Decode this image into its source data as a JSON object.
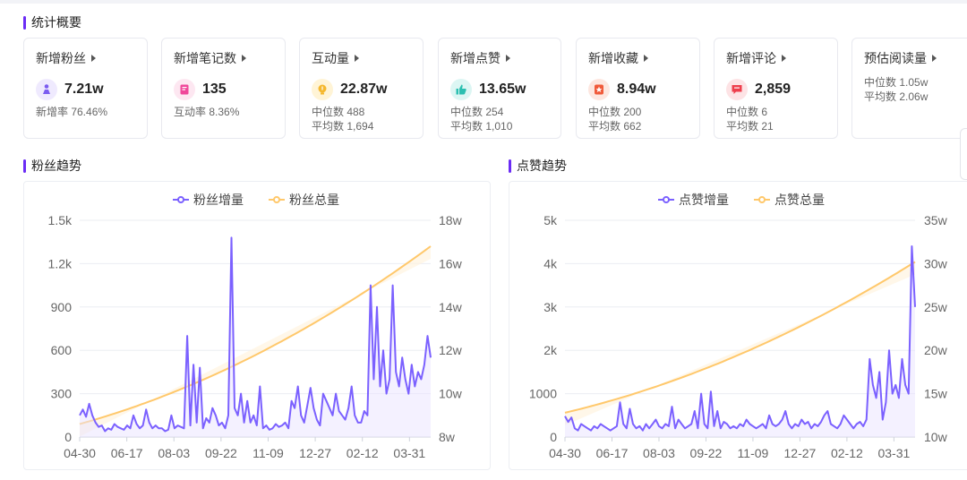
{
  "overview": {
    "title": "统计概要",
    "cards": [
      {
        "title": "新增粉丝",
        "value": "7.21w",
        "icon": "fans-icon",
        "icon_color": "#7b5cf0",
        "icon_bg": "#efeafe",
        "lines": [
          "新增率 76.46%"
        ]
      },
      {
        "title": "新增笔记数",
        "value": "135",
        "icon": "note-icon",
        "icon_color": "#f0479a",
        "icon_bg": "#fde7f1",
        "lines": [
          "互动率 8.36%"
        ]
      },
      {
        "title": "互动量",
        "value": "22.87w",
        "icon": "interaction-icon",
        "icon_color": "#f5b82e",
        "icon_bg": "#fff4d6",
        "lines": [
          "中位数 488",
          "平均数 1,694"
        ]
      },
      {
        "title": "新增点赞",
        "value": "13.65w",
        "icon": "thumb-up-icon",
        "icon_color": "#2bbfb0",
        "icon_bg": "#dcf6f3",
        "lines": [
          "中位数 254",
          "平均数 1,010"
        ]
      },
      {
        "title": "新增收藏",
        "value": "8.94w",
        "icon": "star-icon",
        "icon_color": "#f05a3a",
        "icon_bg": "#fde6df",
        "lines": [
          "中位数 200",
          "平均数 662"
        ]
      },
      {
        "title": "新增评论",
        "value": "2,859",
        "icon": "comment-icon",
        "icon_color": "#ee3f4d",
        "icon_bg": "#fde3e5",
        "lines": [
          "中位数 6",
          "平均数 21"
        ]
      },
      {
        "title": "预估阅读量",
        "value": "",
        "icon": "",
        "icon_color": "",
        "icon_bg": "",
        "lines": [
          "中位数 1.05w",
          "平均数 2.06w"
        ]
      }
    ]
  },
  "charts": [
    {
      "title": "粉丝趋势"
    },
    {
      "title": "点赞趋势"
    }
  ],
  "chart_data": [
    {
      "type": "line",
      "x_ticks": [
        "04-30",
        "06-17",
        "08-03",
        "09-22",
        "11-09",
        "12-27",
        "02-12",
        "03-31"
      ],
      "y_left_ticks": [
        "0",
        "300",
        "600",
        "900",
        "1.2k",
        "1.5k"
      ],
      "y_left_range": [
        0,
        1500
      ],
      "y_right_ticks": [
        "8w",
        "10w",
        "12w",
        "14w",
        "16w",
        "18w"
      ],
      "y_right_range": [
        80000,
        180000
      ],
      "grid": true,
      "legend_position": "top-center",
      "series": [
        {
          "name": "粉丝增量",
          "axis": "left",
          "color": "#7b61ff",
          "values": [
            150,
            190,
            140,
            230,
            150,
            100,
            70,
            80,
            40,
            60,
            50,
            90,
            70,
            60,
            50,
            80,
            60,
            150,
            90,
            60,
            80,
            190,
            100,
            60,
            80,
            60,
            60,
            40,
            50,
            150,
            60,
            80,
            70,
            60,
            700,
            80,
            500,
            100,
            480,
            60,
            130,
            100,
            200,
            150,
            80,
            100,
            60,
            150,
            1380,
            200,
            150,
            300,
            100,
            250,
            100,
            150,
            80,
            350,
            60,
            80,
            50,
            60,
            90,
            70,
            80,
            100,
            60,
            250,
            200,
            350,
            150,
            100,
            220,
            340,
            200,
            120,
            80,
            300,
            250,
            200,
            150,
            300,
            180,
            150,
            120,
            200,
            350,
            150,
            100,
            100,
            180,
            150,
            1050,
            400,
            900,
            350,
            600,
            300,
            400,
            1050,
            450,
            350,
            550,
            400,
            300,
            500,
            350,
            450,
            400,
            500,
            700,
            550
          ],
          "labels_every": 0
        },
        {
          "name": "粉丝总量",
          "axis": "right",
          "color": "#ffc86b",
          "start": 86000,
          "end": 168000
        }
      ]
    },
    {
      "type": "line",
      "x_ticks": [
        "04-30",
        "06-17",
        "08-03",
        "09-22",
        "11-09",
        "12-27",
        "02-12",
        "03-31"
      ],
      "y_left_ticks": [
        "0",
        "1000",
        "2k",
        "3k",
        "4k",
        "5k"
      ],
      "y_left_range": [
        0,
        5000
      ],
      "y_right_ticks": [
        "10w",
        "15w",
        "20w",
        "25w",
        "30w",
        "35w"
      ],
      "y_right_range": [
        100000,
        350000
      ],
      "grid": true,
      "legend_position": "top-center",
      "series": [
        {
          "name": "点赞增量",
          "axis": "left",
          "color": "#7b61ff",
          "values": [
            480,
            350,
            450,
            200,
            150,
            300,
            250,
            200,
            150,
            250,
            200,
            300,
            250,
            200,
            150,
            200,
            250,
            800,
            300,
            200,
            650,
            300,
            200,
            250,
            150,
            300,
            200,
            300,
            400,
            250,
            200,
            300,
            250,
            700,
            200,
            400,
            300,
            200,
            250,
            300,
            600,
            200,
            1000,
            300,
            200,
            1050,
            250,
            600,
            200,
            350,
            300,
            200,
            250,
            200,
            300,
            250,
            400,
            300,
            250,
            200,
            250,
            300,
            200,
            500,
            300,
            250,
            300,
            400,
            600,
            300,
            200,
            300,
            250,
            400,
            300,
            350,
            200,
            300,
            250,
            350,
            500,
            600,
            300,
            250,
            200,
            300,
            500,
            400,
            300,
            200,
            300,
            350,
            250,
            400,
            1800,
            1200,
            900,
            1500,
            400,
            800,
            2000,
            1000,
            1200,
            900,
            1800,
            1200,
            1000,
            4400,
            3000
          ]
        },
        {
          "name": "点赞总量",
          "axis": "right",
          "color": "#ffc86b",
          "start": 128000,
          "end": 302000
        }
      ]
    }
  ]
}
